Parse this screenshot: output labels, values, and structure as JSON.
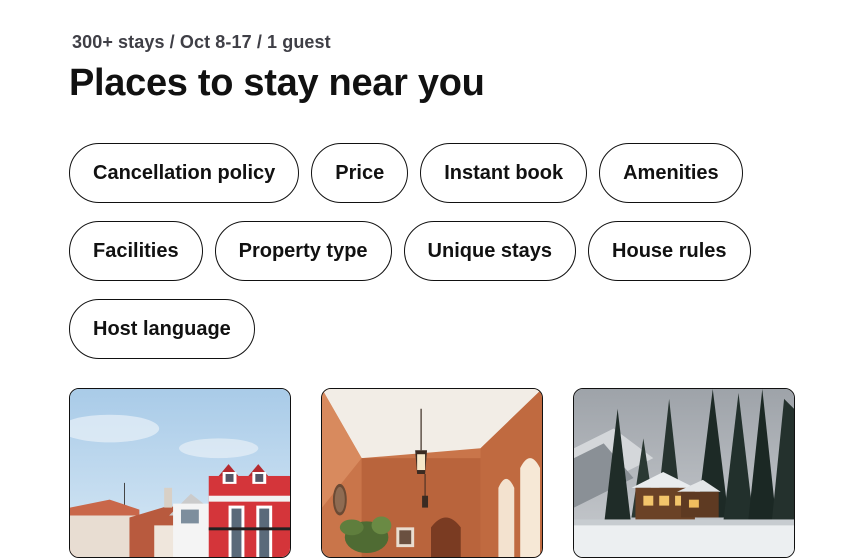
{
  "header": {
    "subtitle": "300+ stays / Oct 8-17 / 1 guest",
    "title": "Places to stay near you"
  },
  "filters": {
    "rows": [
      [
        "Cancellation policy",
        "Price",
        "Instant book",
        "Amenities"
      ],
      [
        "Facilities",
        "Property type",
        "Unique stays",
        "House rules"
      ],
      [
        "Host language"
      ]
    ]
  },
  "listings": [
    {
      "photo": "red-townhouse-photo",
      "colors": {
        "sky": "#bcd8ef",
        "building": "#d4353a"
      }
    },
    {
      "photo": "terracotta-hallway-photo",
      "colors": {
        "wall": "#c9754a",
        "ceiling": "#f2ede6"
      }
    },
    {
      "photo": "snowy-cabin-photo",
      "colors": {
        "sky": "#b7bcc2",
        "trees": "#22302c"
      }
    }
  ]
}
